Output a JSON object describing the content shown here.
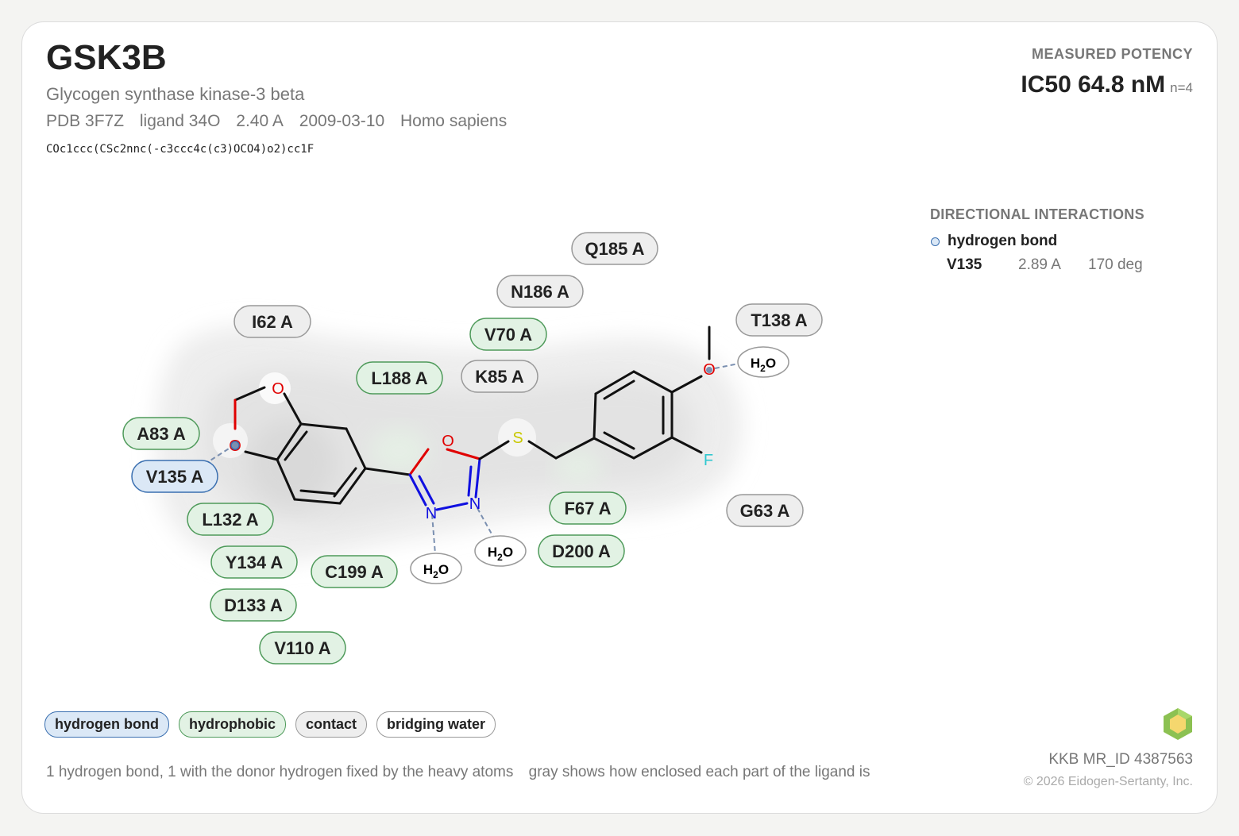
{
  "header": {
    "target": "GSK3B",
    "full_name": "Glycogen synthase kinase-3 beta",
    "pdb": "PDB 3F7Z",
    "ligand": "ligand 34O",
    "resolution": "2.40 A",
    "date": "2009-03-10",
    "organism": "Homo sapiens",
    "smiles": "COc1ccc(CSc2nnc(-c3ccc4c(c3)OCO4)o2)cc1F"
  },
  "potency": {
    "label": "MEASURED POTENCY",
    "value": "IC50 64.8 nM",
    "n": "n=4"
  },
  "directional": {
    "heading": "DIRECTIONAL INTERACTIONS",
    "type": "hydrogen bond",
    "residue": "V135",
    "distance": "2.89 A",
    "angle": "170 deg"
  },
  "atoms": {
    "O": "O",
    "N": "N",
    "S": "S",
    "F": "F",
    "water_H": "H",
    "water_sub": "2",
    "water_O": "O"
  },
  "residues": [
    {
      "label": "Q185 A",
      "type": "contact"
    },
    {
      "label": "N186 A",
      "type": "contact"
    },
    {
      "label": "I62 A",
      "type": "contact"
    },
    {
      "label": "V70 A",
      "type": "hydrophobic"
    },
    {
      "label": "T138 A",
      "type": "contact"
    },
    {
      "label": "L188 A",
      "type": "hydrophobic"
    },
    {
      "label": "K85 A",
      "type": "contact"
    },
    {
      "label": "A83 A",
      "type": "hydrophobic"
    },
    {
      "label": "V135 A",
      "type": "hydrogen bond"
    },
    {
      "label": "L132 A",
      "type": "hydrophobic"
    },
    {
      "label": "F67 A",
      "type": "hydrophobic"
    },
    {
      "label": "G63 A",
      "type": "contact"
    },
    {
      "label": "D200 A",
      "type": "hydrophobic"
    },
    {
      "label": "Y134 A",
      "type": "hydrophobic"
    },
    {
      "label": "C199 A",
      "type": "hydrophobic"
    },
    {
      "label": "D133 A",
      "type": "hydrophobic"
    },
    {
      "label": "V110 A",
      "type": "hydrophobic"
    }
  ],
  "legend": {
    "hbond": "hydrogen bond",
    "hydrophobic": "hydrophobic",
    "contact": "contact",
    "water": "bridging water"
  },
  "colors": {
    "hbond_fill": "#dbe8f6",
    "hbond_stroke": "#3a6fb0",
    "hydrophobic_fill": "#e2f2e4",
    "hydrophobic_stroke": "#4e9a5a",
    "contact_fill": "#eeeeee",
    "contact_stroke": "#999999",
    "oxygen": "#e00000",
    "nitrogen": "#1010e0",
    "sulfur": "#c8c800",
    "fluorine": "#30c8d0"
  },
  "footer": {
    "caption_1": "1 hydrogen bond, 1 with the donor hydrogen fixed by the heavy atoms",
    "caption_2": "gray shows how enclosed each part of the ligand is",
    "mr_id": "KKB MR_ID 4387563",
    "copyright": "© 2026 Eidogen-Sertanty, Inc."
  }
}
